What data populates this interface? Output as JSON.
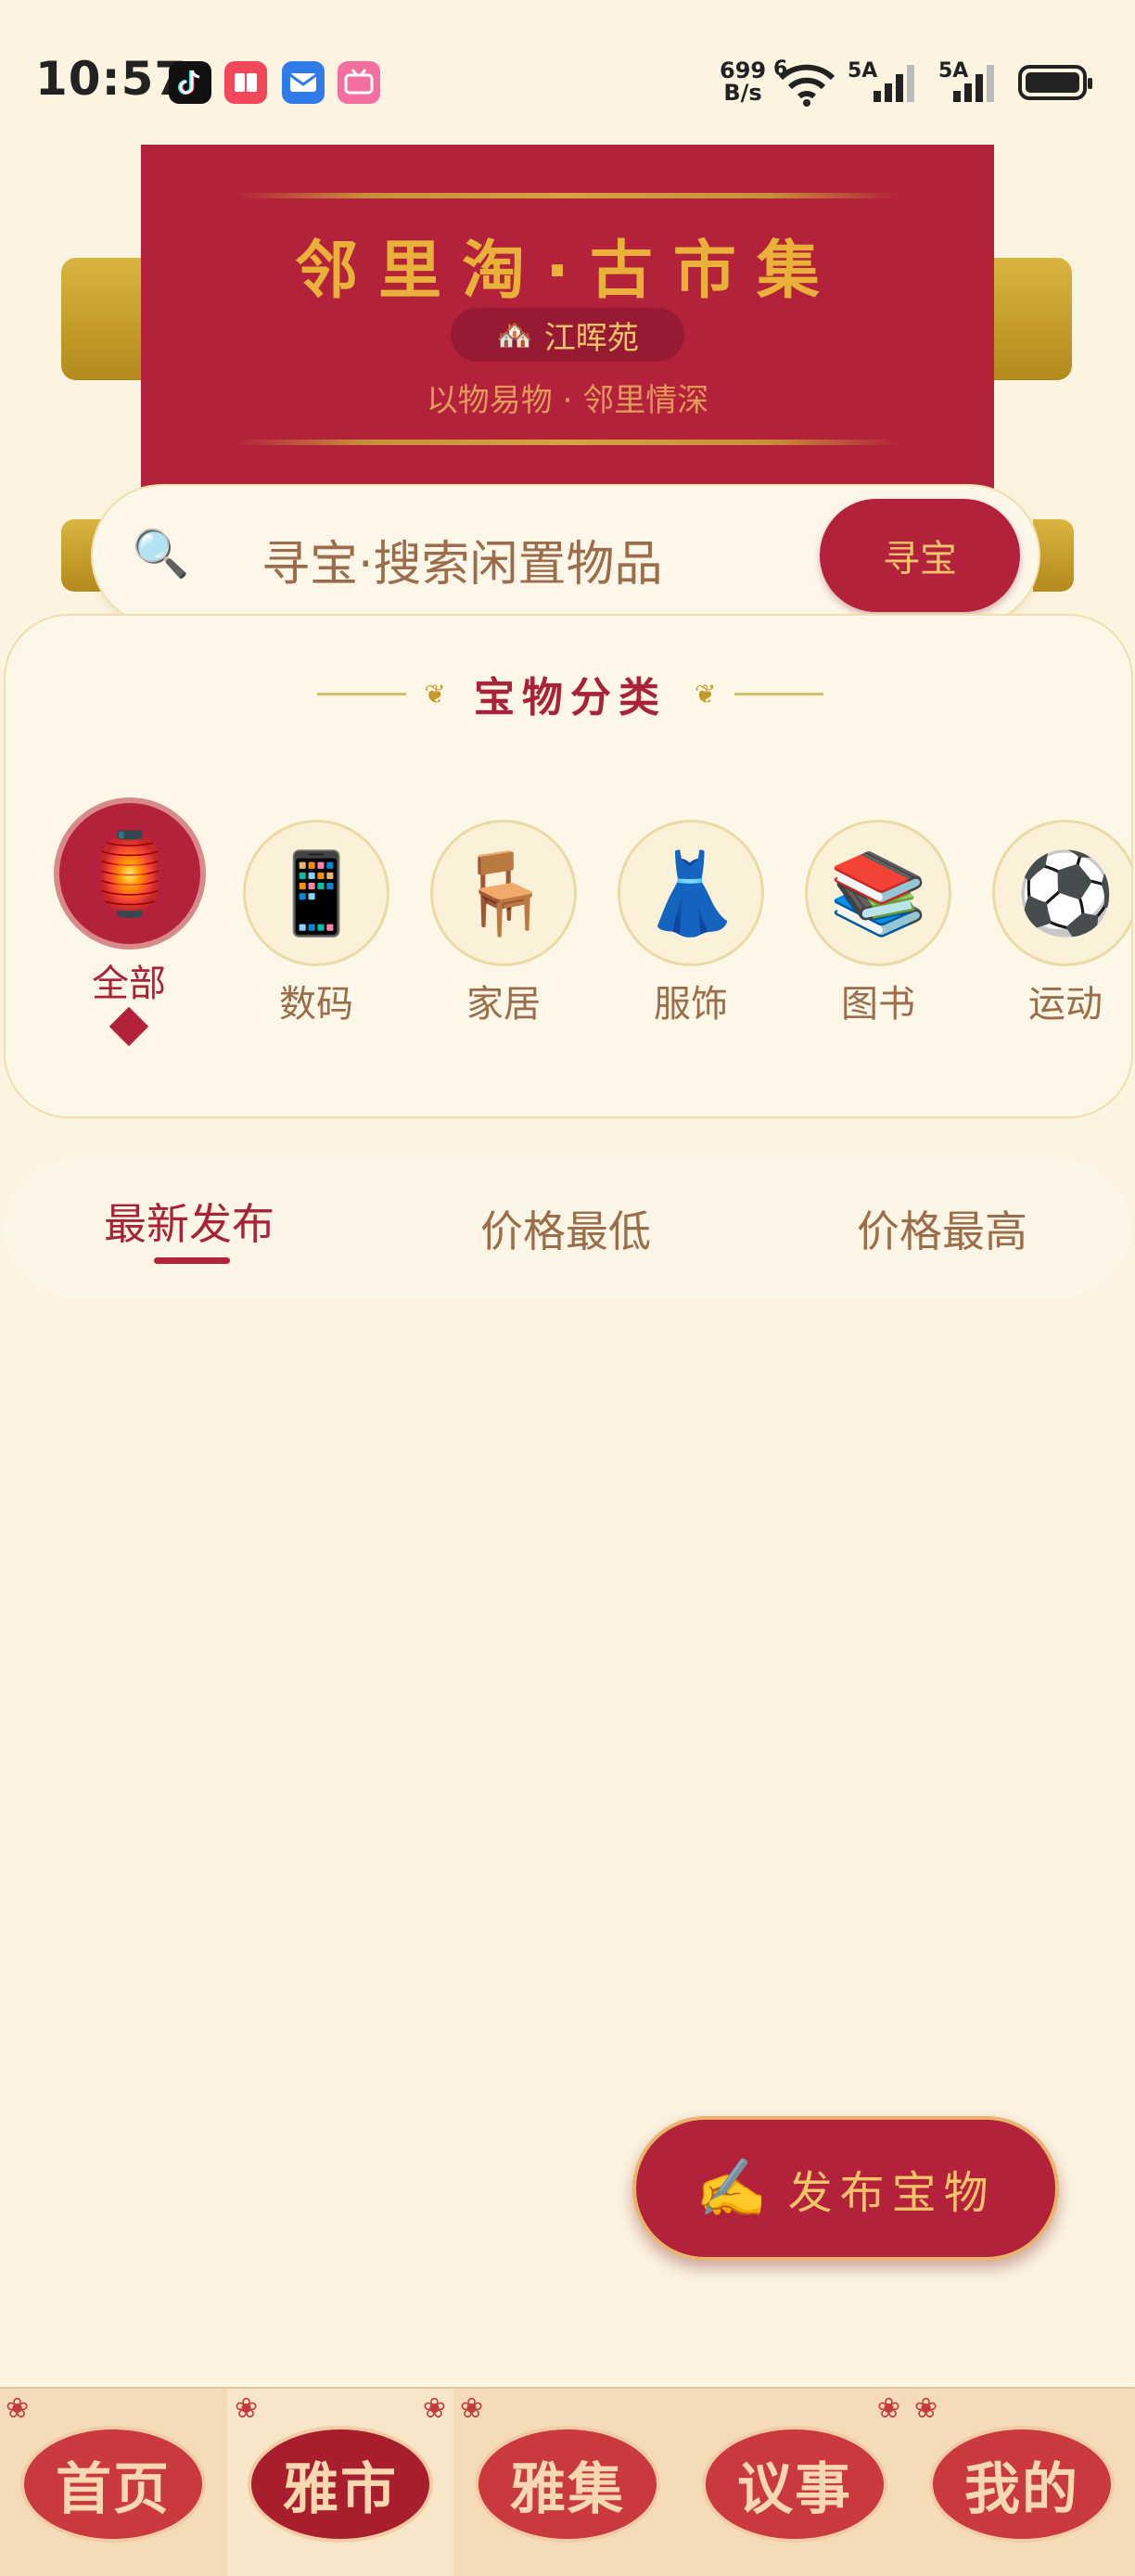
{
  "status_bar": {
    "time": "10:57",
    "net_speed_value": "699",
    "net_speed_unit": "B/s",
    "wifi_label": "6",
    "sim1_label": "5A",
    "sim2_label": "5A",
    "battery_level": 1.0
  },
  "banner": {
    "title": "邻里淘·古市集",
    "community_icon": "house-icon",
    "community_name": "江晖苑",
    "subtitle": "以物易物 · 邻里情深"
  },
  "search": {
    "placeholder": "寻宝·搜索闲置物品",
    "button_label": "寻宝"
  },
  "categories": {
    "title": "宝物分类",
    "items": [
      {
        "label": "全部",
        "icon": "lantern-icon"
      },
      {
        "label": "数码",
        "icon": "phone-icon"
      },
      {
        "label": "家居",
        "icon": "chair-icon"
      },
      {
        "label": "服饰",
        "icon": "dress-icon"
      },
      {
        "label": "图书",
        "icon": "books-icon"
      },
      {
        "label": "运动",
        "icon": "soccer-ball-icon"
      }
    ],
    "selected": "全部"
  },
  "sort_tabs": {
    "items": [
      "最新发布",
      "价格最低",
      "价格最高"
    ],
    "selected": "最新发布"
  },
  "publish_button": {
    "label": "发布宝物",
    "icon": "writing-hand-icon"
  },
  "bottom_nav": {
    "items": [
      "首页",
      "雅市",
      "雅集",
      "议事",
      "我的"
    ],
    "selected": "雅市"
  },
  "colors": {
    "accent_red": "#b3213a",
    "gold": "#e9b13a",
    "background": "#fcf3e1"
  }
}
